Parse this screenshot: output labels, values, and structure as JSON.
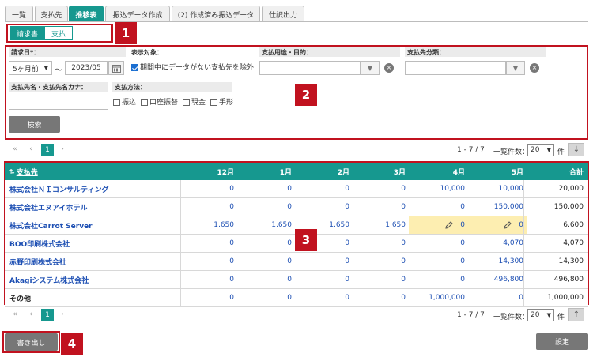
{
  "tabs": [
    {
      "label": "一覧"
    },
    {
      "label": "支払先"
    },
    {
      "label": "推移表"
    },
    {
      "label": "振込データ作成"
    },
    {
      "label": "(2) 作成済み振込データ"
    },
    {
      "label": "仕訳出力"
    }
  ],
  "toggle": {
    "invoice": "請求書",
    "payment": "支払"
  },
  "annotations": [
    "1",
    "2",
    "3",
    "4"
  ],
  "filters": {
    "billing_date_label": "請求日*：",
    "period_select": "5ヶ月前",
    "range_sep": "〜",
    "end_month": "2023/05",
    "target_label": "表示対象：",
    "exclude_label": "期間中にデータがない支払先を除外",
    "purpose_label": "支払用途・目的：",
    "category_label": "支払先分類：",
    "name_label": "支払先名・支払先名カナ：",
    "method_label": "支払方法：",
    "methods": [
      "振込",
      "口座振替",
      "現金",
      "手形"
    ],
    "search_button": "検索"
  },
  "pagination": {
    "first": "«",
    "prev": "‹",
    "current": "1",
    "next": "›",
    "range": "1 - 7 / 7",
    "per_page_label": "一覧件数：",
    "per_page": "20",
    "unit": "件"
  },
  "table": {
    "headers": {
      "name": "支払先",
      "m12": "12月",
      "m1": "1月",
      "m2": "2月",
      "m3": "3月",
      "m4": "4月",
      "m5": "5月",
      "total": "合計"
    },
    "rows": [
      {
        "name": "株式会社ＮＩコンサルティング",
        "m12": "0",
        "m1": "0",
        "m2": "0",
        "m3": "0",
        "m4": "10,000",
        "m5": "10,000",
        "total": "20,000"
      },
      {
        "name": "株式会社エヌアイホテル",
        "m12": "0",
        "m1": "0",
        "m2": "0",
        "m3": "0",
        "m4": "0",
        "m5": "150,000",
        "total": "150,000"
      },
      {
        "name": "株式会社Carrot Server",
        "m12": "1,650",
        "m1": "1,650",
        "m2": "1,650",
        "m3": "1,650",
        "m4": "0",
        "m5": "0",
        "total": "6,600"
      },
      {
        "name": "BOO印刷株式会社",
        "m12": "0",
        "m1": "0",
        "m2": "0",
        "m3": "0",
        "m4": "0",
        "m5": "4,070",
        "total": "4,070"
      },
      {
        "name": "赤野印刷株式会社",
        "m12": "0",
        "m1": "0",
        "m2": "0",
        "m3": "0",
        "m4": "0",
        "m5": "14,300",
        "total": "14,300"
      },
      {
        "name": "Akagiシステム株式会社",
        "m12": "0",
        "m1": "0",
        "m2": "0",
        "m3": "0",
        "m4": "0",
        "m5": "496,800",
        "total": "496,800"
      },
      {
        "name": "その他",
        "m12": "0",
        "m1": "0",
        "m2": "0",
        "m3": "0",
        "m4": "1,000,000",
        "m5": "0",
        "total": "1,000,000"
      }
    ]
  },
  "footer": {
    "export_button": "書き出し",
    "settings_button": "設定"
  },
  "colors": {
    "accent": "#16988f",
    "annotation": "#c1121f",
    "highlight": "#fdeeb1",
    "link": "#1d4fb3"
  }
}
